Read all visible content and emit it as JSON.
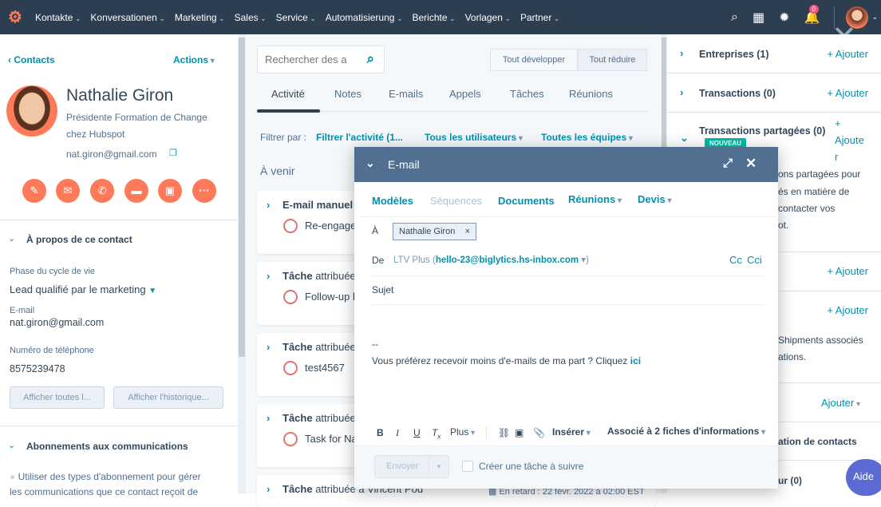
{
  "nav": {
    "items": [
      "Kontakte",
      "Konversationen",
      "Marketing",
      "Sales",
      "Service",
      "Automatisierung",
      "Berichte",
      "Vorlagen",
      "Partner"
    ],
    "notifications": "0"
  },
  "left": {
    "back": "Contacts",
    "actions": "Actions",
    "name": "Nathalie Giron",
    "title_line1": "Présidente Formation de Change",
    "title_line2": "chez Hubspot",
    "email": "nat.giron@gmail.com",
    "about_title": "À propos de ce contact",
    "lifecycle_label": "Phase du cycle de vie",
    "lifecycle_value": "Lead qualifié par le marketing",
    "email_label": "E-mail",
    "email_value": "nat.giron@gmail.com",
    "phone_label": "Numéro de téléphone",
    "phone_value": "8575239478",
    "btn_all": "Afficher toutes l...",
    "btn_history": "Afficher l'historique...",
    "subs_title": "Abonnements aux communications",
    "subs_text1": "Utiliser des types d'abonnement pour gérer",
    "subs_text2": "les communications que ce contact reçoit de"
  },
  "mid": {
    "search_placeholder": "Rechercher des a",
    "expand": "Tout développer",
    "collapse": "Tout réduire",
    "tabs": [
      "Activité",
      "Notes",
      "E-mails",
      "Appels",
      "Tâches",
      "Réunions"
    ],
    "filter_label": "Filtrer par :",
    "filter_activity": "Filtrer l'activité (1...",
    "filter_users": "Tous les utilisateurs",
    "filter_teams": "Toutes les équipes",
    "upcoming": "À venir",
    "cards": [
      {
        "title": "E-mail manuel a",
        "rest": "",
        "sub": "Re-engage"
      },
      {
        "title": "Tâche",
        "rest": " attribuée",
        "sub": "Follow-up l"
      },
      {
        "title": "Tâche",
        "rest": " attribuée",
        "sub": "test4567"
      },
      {
        "title": "Tâche",
        "rest": " attribuée",
        "sub": "Task for Na"
      },
      {
        "title": "Tâche",
        "rest": " attribuée à Vincent Pou",
        "sub": ""
      }
    ],
    "overdue": "En retard : 22 févr. 2022 à 02:00 EST"
  },
  "right": {
    "companies": "Entreprises (1)",
    "deals": "Transactions (0)",
    "shared_deals": "Transactions partagées (0)",
    "new_badge": "NOUVEAU",
    "add": "+ Ajouter",
    "add_wrapped": [
      "+",
      "Ajoute",
      "r"
    ],
    "shared_text": [
      "ons partagées pour",
      "és en matière de",
      "contacter vos",
      "ot."
    ],
    "shipments_text": [
      "Shipments associés",
      "ations."
    ],
    "add_dropdown": "Ajouter",
    "contacts_assoc": "ation de contacts",
    "last_row": "ur (0)",
    "help": "Aide"
  },
  "email": {
    "title": "E-mail",
    "toolbar": [
      "Modèles",
      "Séquences",
      "Documents",
      "Réunions",
      "Devis"
    ],
    "to_label": "À",
    "to_chip": "Nathalie Giron",
    "from_label": "De",
    "from_name": "LTV Plus (",
    "from_addr": "hello-23@biglytics.hs-inbox.com",
    "from_end": ")",
    "cc": "Cc",
    "bcc": "Cci",
    "subject": "Sujet",
    "sig_dash": "--",
    "body": "Vous préférez recevoir moins d'e-mails de ma part ? Cliquez ",
    "body_link": "ici",
    "fmt_more": "Plus",
    "fmt_insert": "Insérer",
    "associated": "Associé à 2 fiches d'informations",
    "send": "Envoyer",
    "followup": "Créer une tâche à suivre"
  }
}
